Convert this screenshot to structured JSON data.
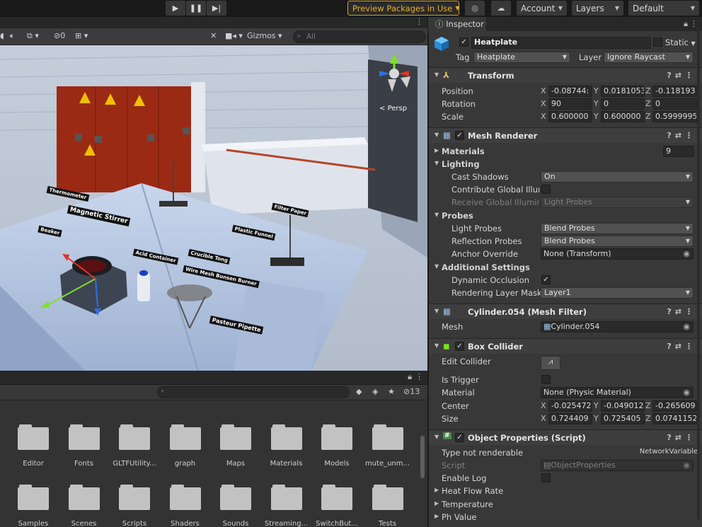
{
  "toolbar": {
    "play_icon": "play-icon",
    "pause_icon": "pause-icon",
    "step_icon": "step-icon",
    "preview_packages": "Preview Packages in Use",
    "account": "Account",
    "layers": "Layers",
    "layout": "Default"
  },
  "scene": {
    "gizmos": "Gizmos",
    "search_placeholder": "All",
    "hidden_count": "0",
    "persp": "Persp",
    "labels": [
      "Thermometer",
      "Magnetic Stirrer",
      "Crucible Tong",
      "Plastic Funnel",
      "Pasteur Pipette",
      "Wire Mesh Bunsen Burner",
      "Acid Container",
      "Filter Paper",
      "Beaker"
    ]
  },
  "project": {
    "hidden_count": "13",
    "folders": [
      "Editor",
      "Fonts",
      "GLTFUtility...",
      "graph",
      "Maps",
      "Materials",
      "Models",
      "mute_unm...",
      "Samples",
      "Scenes",
      "Scripts",
      "Shaders",
      "Sounds",
      "Streaming...",
      "SwitchBut...",
      "Tests"
    ]
  },
  "inspector": {
    "tab": "Inspector",
    "object_name": "Heatplate",
    "static_label": "Static",
    "tag_label": "Tag",
    "tag_value": "Heatplate",
    "layer_label": "Layer",
    "layer_value": "Ignore Raycast",
    "transform": {
      "title": "Transform",
      "position_label": "Position",
      "px": "-0.08744:",
      "py": "0.0181053",
      "pz": "-0.118193",
      "rotation_label": "Rotation",
      "rx": "90",
      "ry": "0",
      "rz": "0",
      "scale_label": "Scale",
      "sx": "0.600000",
      "sy": "0.600000",
      "sz": "0.5999995"
    },
    "mesh_renderer": {
      "title": "Mesh Renderer",
      "materials": "Materials",
      "materials_count": "9",
      "lighting": "Lighting",
      "cast_shadows": "Cast Shadows",
      "cast_shadows_value": "On",
      "contribute_gi": "Contribute Global Illumin",
      "receive_gi": "Receive Global Illuminat",
      "receive_gi_value": "Light Probes",
      "probes": "Probes",
      "light_probes": "Light Probes",
      "light_probes_value": "Blend Probes",
      "reflection_probes": "Reflection Probes",
      "reflection_probes_value": "Blend Probes",
      "anchor_override": "Anchor Override",
      "anchor_override_value": "None (Transform)",
      "additional": "Additional Settings",
      "dynamic_occlusion": "Dynamic Occlusion",
      "rendering_layer_mask": "Rendering Layer Mask",
      "rendering_layer_mask_value": "Layer1"
    },
    "mesh_filter": {
      "title": "Cylinder.054 (Mesh Filter)",
      "mesh_label": "Mesh",
      "mesh_value": "Cylinder.054"
    },
    "box_collider": {
      "title": "Box Collider",
      "edit_collider": "Edit Collider",
      "is_trigger": "Is Trigger",
      "material": "Material",
      "material_value": "None (Physic Material)",
      "center": "Center",
      "cx": "-0.025472",
      "cy": "-0.049012",
      "cz": "-0.265609",
      "size": "Size",
      "szx": "0.724409",
      "szy": "0.725405",
      "szz": "0.0741152"
    },
    "object_properties": {
      "title": "Object Properties (Script)",
      "type_not_renderable": "Type not renderable",
      "network_variable": "NetworkVariable",
      "script": "Script",
      "script_value": "ObjectProperties",
      "enable_log": "Enable Log",
      "heat_flow_rate": "Heat Flow Rate",
      "temperature": "Temperature",
      "ph_value": "Ph Value"
    }
  }
}
